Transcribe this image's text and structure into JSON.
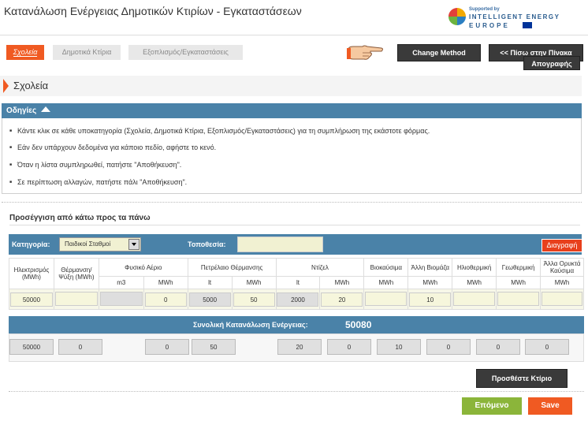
{
  "page": {
    "title": "Κατανάλωση Ενέργειας Δημοτικών Κτιρίων - Εγκαταστάσεων"
  },
  "logo": {
    "supported_by": "Supported by",
    "line1": "INTELLIGENT ENERGY",
    "line2": "EUROPE"
  },
  "tabs": [
    {
      "label": "Σχολεία",
      "active": true
    },
    {
      "label": "Δημοτικά Κτίρια",
      "active": false
    },
    {
      "label": "Εξοπλισμός/Εγκαταστάσεις",
      "active": false
    }
  ],
  "toolbar": {
    "change_method": "Change Method",
    "back": "<< Πίσω στην Πίνακα",
    "inventory": "Απογραφής"
  },
  "section": {
    "title": "Σχολεία"
  },
  "instructions": {
    "header": "Οδηγίες",
    "items": [
      "Κάντε κλικ σε κάθε υποκατηγορία (Σχολεία, Δημοτικά Κτίρια, Εξοπλισμός/Εγκαταστάσεις) για τη συμπλήρωση της εκάστοτε φόρμας.",
      "Εάν δεν υπάρχουν δεδομένα για κάποιο πεδίο, αφήστε το κενό.",
      "Όταν η λίστα συμπληρωθεί, πατήστε \"Αποθήκευση\".",
      "Σε περίπτωση αλλαγών, πατήστε πάλι \"Αποθήκευση\"."
    ]
  },
  "approach": {
    "title": "Προσέγγιση από κάτω προς τα πάνω"
  },
  "filters": {
    "category_label": "Κατηγορία:",
    "category_value": "Παιδικοί Σταθμοί",
    "location_label": "Τοποθεσία:",
    "location_value": "",
    "delete_label": "Διαγραφή"
  },
  "table": {
    "headers": {
      "electricity": "Ηλεκτρισμός (MWh)",
      "heating_cooling": "Θέρμανση/Ψύξη (MWh)",
      "natural_gas": "Φυσικό Αέριο",
      "heating_oil": "Πετρέλαιο Θέρμανσης",
      "diesel": "Ντίζελ",
      "biofuels": "Βιοκαύσιμα",
      "other_biomass": "Άλλη Βιομάζα",
      "solar_thermal": "Ηλιοθερμική",
      "geothermal": "Γεωθερμική",
      "other_fossil": "Άλλα Ορυκτά Καύσιμα"
    },
    "units": {
      "m3": "m3",
      "mwh": "MWh",
      "lt": "lt"
    },
    "row": {
      "electricity": "50000",
      "heating_cooling": "",
      "natural_gas_m3": "",
      "natural_gas_mwh": "0",
      "heating_oil_lt": "5000",
      "heating_oil_mwh": "50",
      "diesel_lt": "2000",
      "diesel_mwh": "20",
      "biofuels": "",
      "other_biomass": "10",
      "solar_thermal": "",
      "geothermal": "",
      "other_fossil": ""
    }
  },
  "summary": {
    "label": "Συνολική Κατανάλωση Ενέργειας:",
    "total": "50080",
    "values": [
      "50000",
      "0",
      "0",
      "50",
      "20",
      "0",
      "10",
      "0",
      "0",
      "0"
    ]
  },
  "actions": {
    "add_building": "Προσθέστε Κτίριο",
    "next": "Επόμενο",
    "save": "Save"
  }
}
